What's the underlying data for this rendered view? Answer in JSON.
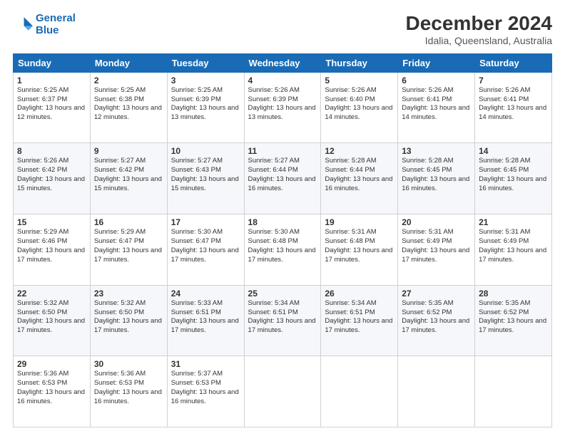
{
  "logo": {
    "line1": "General",
    "line2": "Blue"
  },
  "title": "December 2024",
  "subtitle": "Idalia, Queensland, Australia",
  "days_of_week": [
    "Sunday",
    "Monday",
    "Tuesday",
    "Wednesday",
    "Thursday",
    "Friday",
    "Saturday"
  ],
  "weeks": [
    [
      {
        "day": 1,
        "sunrise": "5:25 AM",
        "sunset": "6:37 PM",
        "daylight": "13 hours and 12 minutes."
      },
      {
        "day": 2,
        "sunrise": "5:25 AM",
        "sunset": "6:38 PM",
        "daylight": "13 hours and 12 minutes."
      },
      {
        "day": 3,
        "sunrise": "5:25 AM",
        "sunset": "6:39 PM",
        "daylight": "13 hours and 13 minutes."
      },
      {
        "day": 4,
        "sunrise": "5:26 AM",
        "sunset": "6:39 PM",
        "daylight": "13 hours and 13 minutes."
      },
      {
        "day": 5,
        "sunrise": "5:26 AM",
        "sunset": "6:40 PM",
        "daylight": "13 hours and 14 minutes."
      },
      {
        "day": 6,
        "sunrise": "5:26 AM",
        "sunset": "6:41 PM",
        "daylight": "13 hours and 14 minutes."
      },
      {
        "day": 7,
        "sunrise": "5:26 AM",
        "sunset": "6:41 PM",
        "daylight": "13 hours and 14 minutes."
      }
    ],
    [
      {
        "day": 8,
        "sunrise": "5:26 AM",
        "sunset": "6:42 PM",
        "daylight": "13 hours and 15 minutes."
      },
      {
        "day": 9,
        "sunrise": "5:27 AM",
        "sunset": "6:42 PM",
        "daylight": "13 hours and 15 minutes."
      },
      {
        "day": 10,
        "sunrise": "5:27 AM",
        "sunset": "6:43 PM",
        "daylight": "13 hours and 15 minutes."
      },
      {
        "day": 11,
        "sunrise": "5:27 AM",
        "sunset": "6:44 PM",
        "daylight": "13 hours and 16 minutes."
      },
      {
        "day": 12,
        "sunrise": "5:28 AM",
        "sunset": "6:44 PM",
        "daylight": "13 hours and 16 minutes."
      },
      {
        "day": 13,
        "sunrise": "5:28 AM",
        "sunset": "6:45 PM",
        "daylight": "13 hours and 16 minutes."
      },
      {
        "day": 14,
        "sunrise": "5:28 AM",
        "sunset": "6:45 PM",
        "daylight": "13 hours and 16 minutes."
      }
    ],
    [
      {
        "day": 15,
        "sunrise": "5:29 AM",
        "sunset": "6:46 PM",
        "daylight": "13 hours and 17 minutes."
      },
      {
        "day": 16,
        "sunrise": "5:29 AM",
        "sunset": "6:47 PM",
        "daylight": "13 hours and 17 minutes."
      },
      {
        "day": 17,
        "sunrise": "5:30 AM",
        "sunset": "6:47 PM",
        "daylight": "13 hours and 17 minutes."
      },
      {
        "day": 18,
        "sunrise": "5:30 AM",
        "sunset": "6:48 PM",
        "daylight": "13 hours and 17 minutes."
      },
      {
        "day": 19,
        "sunrise": "5:31 AM",
        "sunset": "6:48 PM",
        "daylight": "13 hours and 17 minutes."
      },
      {
        "day": 20,
        "sunrise": "5:31 AM",
        "sunset": "6:49 PM",
        "daylight": "13 hours and 17 minutes."
      },
      {
        "day": 21,
        "sunrise": "5:31 AM",
        "sunset": "6:49 PM",
        "daylight": "13 hours and 17 minutes."
      }
    ],
    [
      {
        "day": 22,
        "sunrise": "5:32 AM",
        "sunset": "6:50 PM",
        "daylight": "13 hours and 17 minutes."
      },
      {
        "day": 23,
        "sunrise": "5:32 AM",
        "sunset": "6:50 PM",
        "daylight": "13 hours and 17 minutes."
      },
      {
        "day": 24,
        "sunrise": "5:33 AM",
        "sunset": "6:51 PM",
        "daylight": "13 hours and 17 minutes."
      },
      {
        "day": 25,
        "sunrise": "5:34 AM",
        "sunset": "6:51 PM",
        "daylight": "13 hours and 17 minutes."
      },
      {
        "day": 26,
        "sunrise": "5:34 AM",
        "sunset": "6:51 PM",
        "daylight": "13 hours and 17 minutes."
      },
      {
        "day": 27,
        "sunrise": "5:35 AM",
        "sunset": "6:52 PM",
        "daylight": "13 hours and 17 minutes."
      },
      {
        "day": 28,
        "sunrise": "5:35 AM",
        "sunset": "6:52 PM",
        "daylight": "13 hours and 17 minutes."
      }
    ],
    [
      {
        "day": 29,
        "sunrise": "5:36 AM",
        "sunset": "6:53 PM",
        "daylight": "13 hours and 16 minutes."
      },
      {
        "day": 30,
        "sunrise": "5:36 AM",
        "sunset": "6:53 PM",
        "daylight": "13 hours and 16 minutes."
      },
      {
        "day": 31,
        "sunrise": "5:37 AM",
        "sunset": "6:53 PM",
        "daylight": "13 hours and 16 minutes."
      },
      null,
      null,
      null,
      null
    ]
  ]
}
